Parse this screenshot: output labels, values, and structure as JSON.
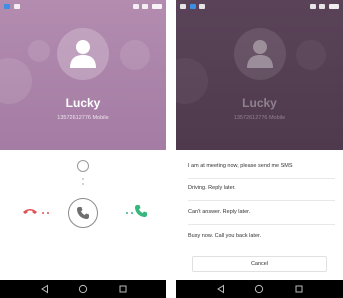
{
  "incoming_call": {
    "caller_name": "Lucky",
    "caller_number": "13572612776 Mobile"
  },
  "quick_reply": {
    "caller_name": "Lucky",
    "caller_number": "13572612776 Mobile",
    "messages": [
      "I am at meeting now, please send me SMS",
      "Driving. Reply later.",
      "Can't answer. Reply later.",
      "Busy now. Call you back later."
    ],
    "cancel_label": "Cancel"
  },
  "colors": {
    "call_background": "#a986a8",
    "dimmed_background": "#523d50",
    "decline": "#e05252",
    "accept": "#37b77c"
  },
  "icons": {
    "avatar": "person-icon",
    "answer": "phone-icon",
    "decline": "phone-hangup-icon",
    "accept": "phone-accept-icon",
    "sms": "message-circle-icon",
    "nav_back": "back-triangle-icon",
    "nav_home": "home-circle-icon",
    "nav_recents": "recents-square-icon"
  }
}
